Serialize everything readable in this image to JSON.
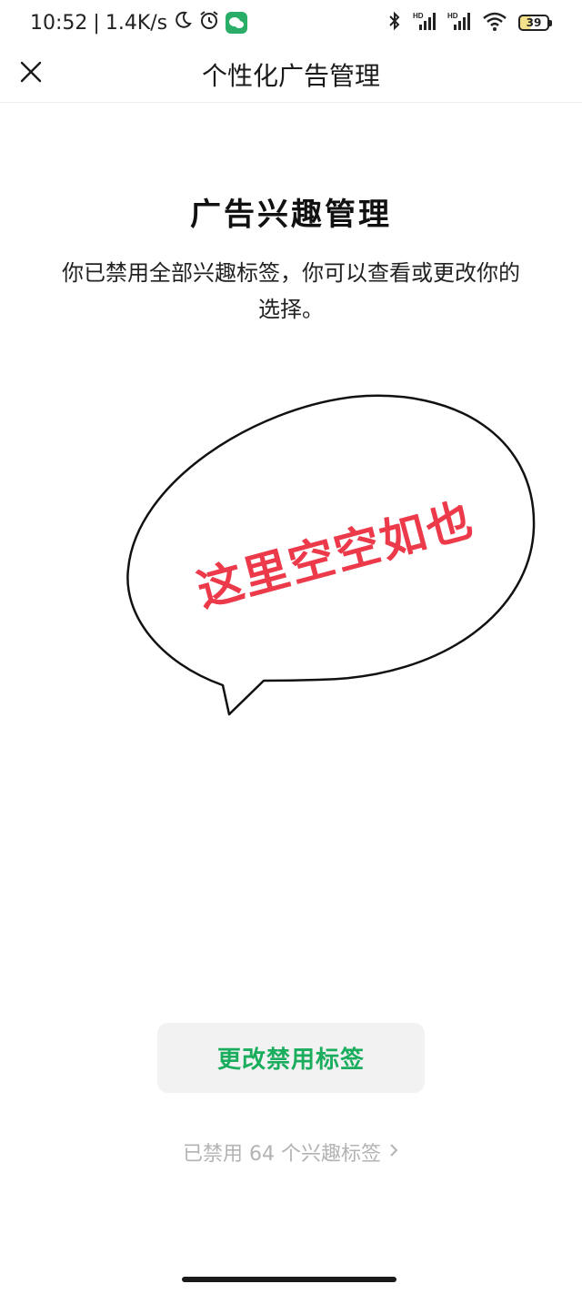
{
  "status_bar": {
    "time": "10:52",
    "separator": "|",
    "speed": "1.4K/s",
    "battery": "39",
    "icons": [
      "moon-icon",
      "alarm-icon",
      "wechat-icon",
      "bluetooth-icon",
      "signal-hd-icon",
      "signal-hd-icon",
      "wifi-icon",
      "battery-icon"
    ]
  },
  "nav": {
    "title": "个性化广告管理",
    "close_icon": "close-icon"
  },
  "content": {
    "heading": "广告兴趣管理",
    "description": "你已禁用全部兴趣标签，你可以查看或更改你的选择。",
    "bubble_text": "这里空空如也"
  },
  "actions": {
    "change_button": "更改禁用标签",
    "disabled_summary": "已禁用 64 个兴趣标签"
  },
  "colors": {
    "accent_green": "#1aad5e",
    "bubble_red": "#ec3a4a",
    "muted_gray": "#b3b3b3"
  }
}
